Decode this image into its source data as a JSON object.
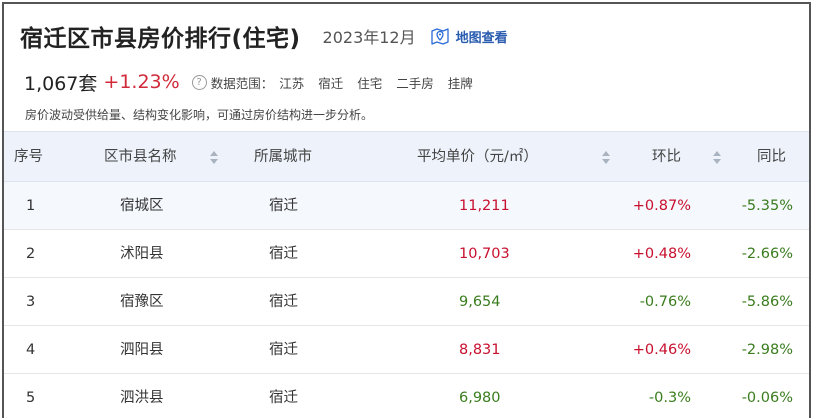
{
  "header": {
    "title": "宿迁区市县房价排行(住宅)",
    "date": "2023年12月",
    "map_link": "地图查看"
  },
  "summary": {
    "count": "1,067套",
    "change": "+1.23%",
    "help_icon": "?",
    "range_label": "数据范围：",
    "tags": [
      "江苏",
      "宿迁",
      "住宅",
      "二手房",
      "挂牌"
    ]
  },
  "note": "房价波动受供给量、结构变化影响，可通过房价结构进一步分析。",
  "table": {
    "headers": {
      "index": "序号",
      "name": "区市县名称",
      "city": "所属城市",
      "price": "平均单价（元/㎡）",
      "mom": "环比",
      "yoy": "同比"
    },
    "rows": [
      {
        "index": "1",
        "name": "宿城区",
        "city": "宿迁",
        "price": "11,211",
        "mom": "+0.87%",
        "yoy": "-5.35%"
      },
      {
        "index": "2",
        "name": "沭阳县",
        "city": "宿迁",
        "price": "10,703",
        "mom": "+0.48%",
        "yoy": "-2.66%"
      },
      {
        "index": "3",
        "name": "宿豫区",
        "city": "宿迁",
        "price": "9,654",
        "mom": "-0.76%",
        "yoy": "-5.86%"
      },
      {
        "index": "4",
        "name": "泗阳县",
        "city": "宿迁",
        "price": "8,831",
        "mom": "+0.46%",
        "yoy": "-2.98%"
      },
      {
        "index": "5",
        "name": "泗洪县",
        "city": "宿迁",
        "price": "6,980",
        "mom": "-0.3%",
        "yoy": "-0.06%"
      }
    ]
  },
  "colors": {
    "up": "#c8102e",
    "down": "#3a7d1e",
    "link": "#2a5db0",
    "header_bg": "#eef3fb"
  },
  "icons": {
    "map": "map-pin-icon",
    "help": "question-circle-icon",
    "sort": "sort-icon"
  }
}
